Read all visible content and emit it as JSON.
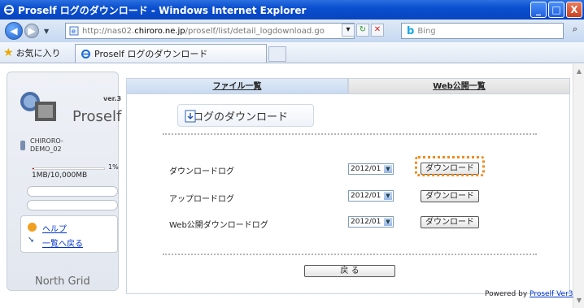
{
  "window": {
    "title": "Proself ログのダウンロード - Windows Internet Explorer",
    "min": "_",
    "max": "□",
    "close": "X"
  },
  "nav": {
    "url_prefix": "http://nas02.",
    "url_domain": "chiroro.ne.jp",
    "url_path": "/proself/list/detail_logdownload.go",
    "search_brand": "b",
    "search_placeholder": "Bing"
  },
  "favorites": {
    "label": "お気に入り",
    "tab_title": "Proself ログのダウンロード"
  },
  "sidebar": {
    "brand": "Proself",
    "version": "ver.3",
    "user_line1": "CHIRORO-",
    "user_line2": "DEMO_02",
    "usage_percent": "1%",
    "usage_fraction": 0.01,
    "quota": "1MB/10,000MB",
    "help_link": "ヘルプ",
    "back_list_link": "一覧へ戻る",
    "footer_logo": "North Grid"
  },
  "tabs": {
    "file_list": "ファイル一覧",
    "web_list": "Web公開一覧"
  },
  "main": {
    "heading": "ログのダウンロード",
    "rows": [
      {
        "label": "ダウンロードログ",
        "month": "2012/01",
        "button": "ダウンロード"
      },
      {
        "label": "アップロードログ",
        "month": "2012/01",
        "button": "ダウンロード"
      },
      {
        "label": "Web公開ダウンロードログ",
        "month": "2012/01",
        "button": "ダウンロード"
      }
    ],
    "back_button": "戻 る"
  },
  "footer": {
    "powered_by": "Powered by",
    "powered_link": "Proself Ver3"
  }
}
